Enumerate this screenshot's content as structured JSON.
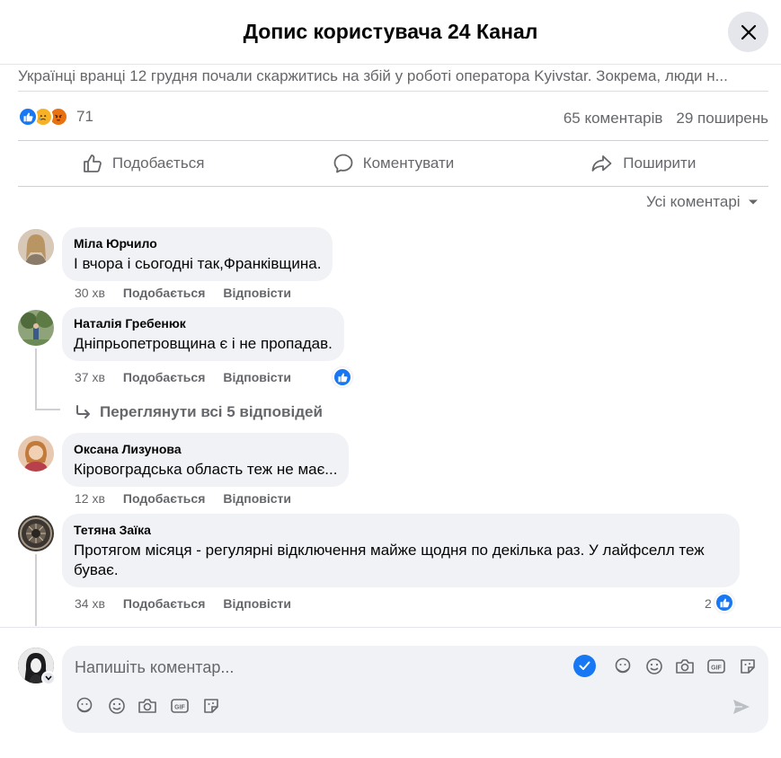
{
  "header": {
    "title": "Допис користувача 24 Канал"
  },
  "post": {
    "preview": "Українці вранці 12 грудня почали скаржитись на збій у роботі оператора Kyivstar. Зокрема, люди н..."
  },
  "stats": {
    "reactions_count": "71",
    "comments": "65 коментарів",
    "shares": "29 поширень"
  },
  "actions": {
    "like": "Подобається",
    "comment": "Коментувати",
    "share": "Поширити"
  },
  "filter": {
    "label": "Усі коментарі"
  },
  "comments": [
    {
      "author": "Міла Юрчило",
      "text": "І вчора і сьогодні так,Франківщина.",
      "time": "30 хв",
      "like": "Подобається",
      "reply": "Відповісти"
    },
    {
      "author": "Наталія Гребенюк",
      "text": "Дніпрьопетровщина є і не пропадав.",
      "time": "37 хв",
      "like": "Подобається",
      "reply": "Відповісти"
    },
    {
      "author": "Оксана Лизунова",
      "text": "Кіровоградська область теж не має...",
      "time": "12 хв",
      "like": "Подобається",
      "reply": "Відповісти"
    },
    {
      "author": "Тетяна Заїка",
      "text": "Протягом місяця - регулярні відключення майже щодня по декілька раз. У лайфселл теж буває.",
      "time": "34 хв",
      "like": "Подобається",
      "reply": "Відповісти",
      "reaction_count": "2"
    }
  ],
  "replies": {
    "label": "Переглянути всі 5 відповідей"
  },
  "composer": {
    "placeholder": "Напишіть коментар..."
  },
  "icons": {
    "like": "thumbs-up-icon",
    "comment": "speech-bubble-icon",
    "share": "share-arrow-icon",
    "close": "close-icon",
    "avatar-sticker": "sticker-icon",
    "emoji": "emoji-icon",
    "camera": "camera-icon",
    "gif": "gif-icon",
    "sticker": "sticker-icon",
    "send": "send-icon"
  },
  "colors": {
    "accent": "#1877f2",
    "text": "#050505",
    "secondary": "#65676b",
    "bubble": "#f0f2f5"
  }
}
